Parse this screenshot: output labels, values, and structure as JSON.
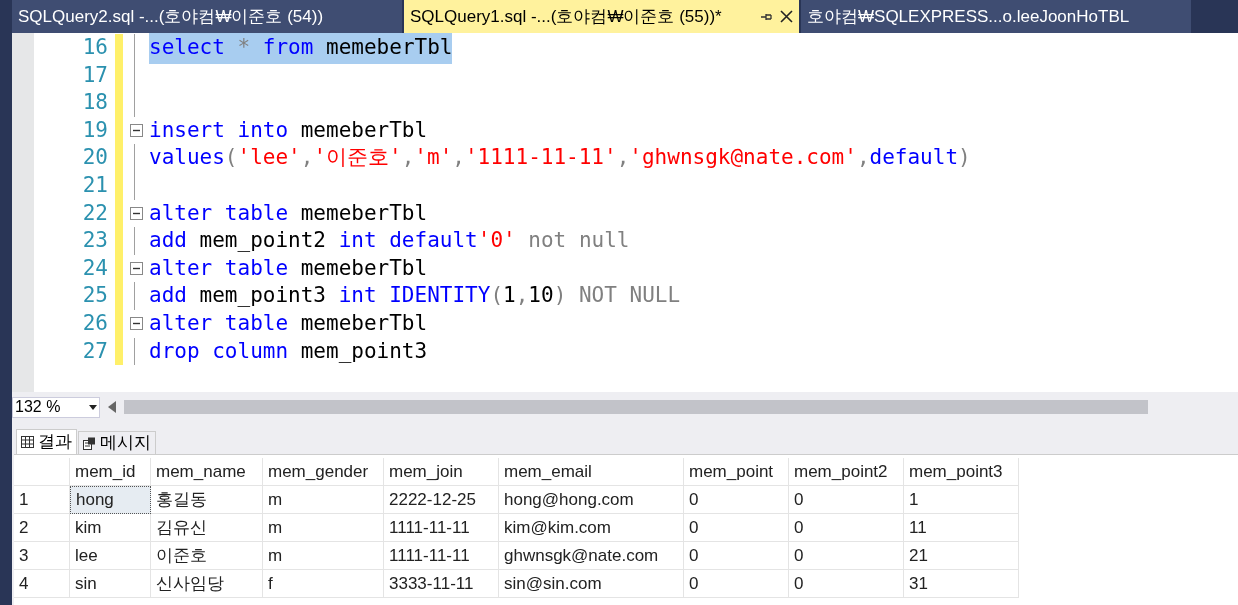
{
  "tabs": [
    {
      "label": "SQLQuery2.sql -...(호야컴₩이준호 (54))",
      "selected": false
    },
    {
      "label": "SQLQuery1.sql -...(호야컴₩이준호 (55))*",
      "selected": true
    },
    {
      "label": "호야컴₩SQLEXPRESS...o.leeJoonHoTBL",
      "selected": false
    }
  ],
  "editor": {
    "lines": [
      {
        "number": "16",
        "kind": "line",
        "tokens": [
          {
            "text": "select",
            "kind": "kw",
            "selected": true
          },
          {
            "text": " * ",
            "kind": "op",
            "selected": true
          },
          {
            "text": "from",
            "kind": "kw",
            "selected": true
          },
          {
            "text": " memeberTbl",
            "kind": "plain",
            "selected": true
          }
        ]
      },
      {
        "number": "17",
        "kind": "line"
      },
      {
        "number": "18",
        "kind": "line"
      },
      {
        "number": "19",
        "kind": "start",
        "tokens": [
          {
            "text": "insert into",
            "kind": "kw",
            "selected": false
          },
          {
            "text": " memeberTbl",
            "kind": "plain",
            "selected": false
          }
        ]
      },
      {
        "number": "20",
        "kind": "line",
        "tokens": [
          {
            "text": "values",
            "kind": "kw",
            "selected": false
          },
          {
            "text": "(",
            "kind": "op",
            "selected": false
          },
          {
            "text": "'lee'",
            "kind": "str",
            "selected": false
          },
          {
            "text": ",",
            "kind": "op",
            "selected": false
          },
          {
            "text": "'이준호'",
            "kind": "str",
            "selected": false
          },
          {
            "text": ",",
            "kind": "op",
            "selected": false
          },
          {
            "text": "'m'",
            "kind": "str",
            "selected": false
          },
          {
            "text": ",",
            "kind": "op",
            "selected": false
          },
          {
            "text": "'1111-11-11'",
            "kind": "str",
            "selected": false
          },
          {
            "text": ",",
            "kind": "op",
            "selected": false
          },
          {
            "text": "'ghwnsgk@nate.com'",
            "kind": "str",
            "selected": false
          },
          {
            "text": ",",
            "kind": "op",
            "selected": false
          },
          {
            "text": "default",
            "kind": "kw",
            "selected": false
          },
          {
            "text": ")",
            "kind": "op",
            "selected": false
          }
        ]
      },
      {
        "number": "21",
        "kind": "line"
      },
      {
        "number": "22",
        "kind": "start",
        "tokens": [
          {
            "text": "alter table",
            "kind": "kw",
            "selected": false
          },
          {
            "text": " memeberTbl",
            "kind": "plain",
            "selected": false
          }
        ]
      },
      {
        "number": "23",
        "kind": "line",
        "tokens": [
          {
            "text": "add",
            "kind": "kw",
            "selected": false
          },
          {
            "text": " mem_point2 ",
            "kind": "plain",
            "selected": false
          },
          {
            "text": "int default",
            "kind": "kw",
            "selected": false
          },
          {
            "text": "'0'",
            "kind": "str",
            "selected": false
          },
          {
            "text": " not null",
            "kind": "op",
            "selected": false
          }
        ]
      },
      {
        "number": "24",
        "kind": "start",
        "tokens": [
          {
            "text": "alter table",
            "kind": "kw",
            "selected": false
          },
          {
            "text": " memeberTbl",
            "kind": "plain",
            "selected": false
          }
        ]
      },
      {
        "number": "25",
        "kind": "line",
        "tokens": [
          {
            "text": "add",
            "kind": "kw",
            "selected": false
          },
          {
            "text": " mem_point3 ",
            "kind": "plain",
            "selected": false
          },
          {
            "text": "int IDENTITY",
            "kind": "kw",
            "selected": false
          },
          {
            "text": "(",
            "kind": "op",
            "selected": false
          },
          {
            "text": "1",
            "kind": "plain",
            "selected": false
          },
          {
            "text": ",",
            "kind": "op",
            "selected": false
          },
          {
            "text": "10",
            "kind": "plain",
            "selected": false
          },
          {
            "text": ") NOT NULL",
            "kind": "op",
            "selected": false
          }
        ]
      },
      {
        "number": "26",
        "kind": "start",
        "tokens": [
          {
            "text": "alter table",
            "kind": "kw",
            "selected": false
          },
          {
            "text": " memeberTbl",
            "kind": "plain",
            "selected": false
          }
        ]
      },
      {
        "number": "27",
        "kind": "line",
        "tokens": [
          {
            "text": "drop column",
            "kind": "kw",
            "selected": false
          },
          {
            "text": " mem_point3",
            "kind": "plain",
            "selected": false
          }
        ]
      }
    ]
  },
  "zoom": "132 %",
  "result_tabs": [
    {
      "label": "결과",
      "kind": "grid",
      "selected": true
    },
    {
      "label": "메시지",
      "kind": "messages",
      "selected": false
    }
  ],
  "grid": {
    "columns": [
      "mem_id",
      "mem_name",
      "mem_gender",
      "mem_join",
      "mem_email",
      "mem_point",
      "mem_point2",
      "mem_point3"
    ],
    "rows": [
      {
        "number": "1",
        "cells": [
          {
            "text": "hong",
            "selected": true
          },
          {
            "text": "홍길동",
            "selected": false
          },
          {
            "text": "m",
            "selected": false
          },
          {
            "text": "2222-12-25",
            "selected": false
          },
          {
            "text": "hong@hong.com",
            "selected": false
          },
          {
            "text": "0",
            "selected": false
          },
          {
            "text": "0",
            "selected": false
          },
          {
            "text": "1",
            "selected": false
          }
        ]
      },
      {
        "number": "2",
        "cells": [
          {
            "text": "kim",
            "selected": false
          },
          {
            "text": "김유신",
            "selected": false
          },
          {
            "text": "m",
            "selected": false
          },
          {
            "text": "1111-11-11",
            "selected": false
          },
          {
            "text": "kim@kim.com",
            "selected": false
          },
          {
            "text": "0",
            "selected": false
          },
          {
            "text": "0",
            "selected": false
          },
          {
            "text": "11",
            "selected": false
          }
        ]
      },
      {
        "number": "3",
        "cells": [
          {
            "text": "lee",
            "selected": false
          },
          {
            "text": "이준호",
            "selected": false
          },
          {
            "text": "m",
            "selected": false
          },
          {
            "text": "1111-11-11",
            "selected": false
          },
          {
            "text": "ghwnsgk@nate.com",
            "selected": false
          },
          {
            "text": "0",
            "selected": false
          },
          {
            "text": "0",
            "selected": false
          },
          {
            "text": "21",
            "selected": false
          }
        ]
      },
      {
        "number": "4",
        "cells": [
          {
            "text": "sin",
            "selected": false
          },
          {
            "text": "신사임당",
            "selected": false
          },
          {
            "text": "f",
            "selected": false
          },
          {
            "text": "3333-11-11",
            "selected": false
          },
          {
            "text": "sin@sin.com",
            "selected": false
          },
          {
            "text": "0",
            "selected": false
          },
          {
            "text": "0",
            "selected": false
          },
          {
            "text": "31",
            "selected": false
          }
        ]
      }
    ]
  }
}
